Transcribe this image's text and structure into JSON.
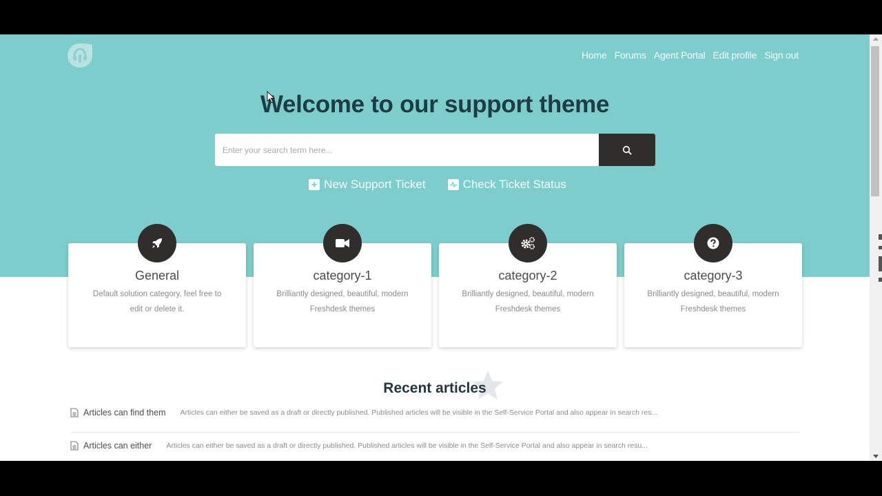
{
  "colors": {
    "hero_bg": "#7ecdcd",
    "title_color": "#1c3d48",
    "dark_button": "#2f2e2c",
    "nav_text": "#f3fbfb"
  },
  "logo": {
    "icon": "headset-logo-icon"
  },
  "nav": {
    "items": [
      {
        "label": "Home"
      },
      {
        "label": "Forums"
      },
      {
        "label": "Agent Portal"
      },
      {
        "label": "Edit profile"
      },
      {
        "label": "Sign out"
      }
    ]
  },
  "hero": {
    "title": "Welcome to our support theme",
    "search": {
      "placeholder": "Enter your search term here...",
      "value": "",
      "button_icon": "search-icon"
    },
    "actions": [
      {
        "label": "New Support Ticket",
        "icon": "plus-square-icon"
      },
      {
        "label": "Check Ticket Status",
        "icon": "pulse-square-icon"
      }
    ]
  },
  "categories": [
    {
      "title": "General",
      "description": "Default solution category, feel free to edit or delete it.",
      "icon": "rocket-icon"
    },
    {
      "title": "category-1",
      "description": "Brilliantly designed, beautiful, modern Freshdesk themes",
      "icon": "video-camera-icon"
    },
    {
      "title": "category-2",
      "description": "Brilliantly designed, beautiful, modern Freshdesk themes",
      "icon": "gears-icon"
    },
    {
      "title": "category-3",
      "description": "Brilliantly designed, beautiful, modern Freshdesk themes",
      "icon": "question-circle-icon"
    }
  ],
  "recent": {
    "title": "Recent articles",
    "articles": [
      {
        "title": "Articles can find them",
        "excerpt": "Articles can either be saved as a draft or directly published. Published articles will be visible in the Self-Service Portal and also appear in search res..."
      },
      {
        "title": "Articles can either",
        "excerpt": "Articles can either be saved as a draft or directly published. Published articles will be visible in the Self-Service Portal and also appear in search resu..."
      }
    ]
  }
}
